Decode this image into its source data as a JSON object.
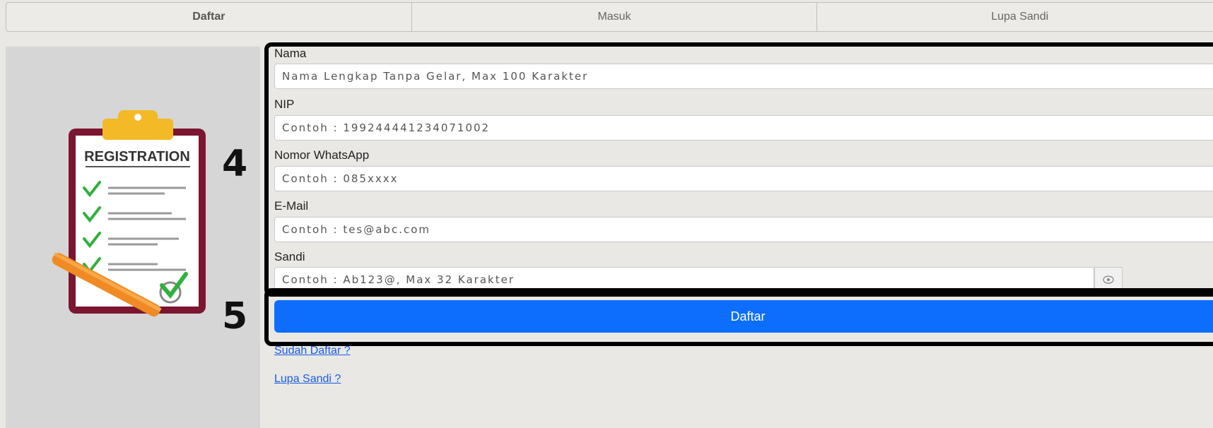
{
  "tabs": [
    {
      "label": "Daftar",
      "active": true
    },
    {
      "label": "Masuk",
      "active": false
    },
    {
      "label": "Lupa Sandi",
      "active": false
    }
  ],
  "illustration": {
    "title": "REGISTRATION"
  },
  "annotations": {
    "box_a": "4",
    "box_b": "5"
  },
  "form": {
    "nama": {
      "label": "Nama",
      "placeholder": "Nama Lengkap Tanpa Gelar, Max 100 Karakter"
    },
    "nip": {
      "label": "NIP",
      "placeholder": "Contoh : 199244441234071002"
    },
    "whatsapp": {
      "label": "Nomor WhatsApp",
      "placeholder": "Contoh : 085xxxx"
    },
    "email": {
      "label": "E-Mail",
      "placeholder": "Contoh : tes@abc.com"
    },
    "sandi": {
      "label": "Sandi",
      "placeholder": "Contoh : Ab123@, Max 32 Karakter"
    },
    "submit_label": "Daftar"
  },
  "links": {
    "sudah_daftar": "Sudah Daftar ?",
    "lupa_sandi": "Lupa Sandi ?"
  },
  "colors": {
    "primary": "#0d6efd",
    "link": "#1a5ce0",
    "clipboard_border": "#7b1530"
  }
}
